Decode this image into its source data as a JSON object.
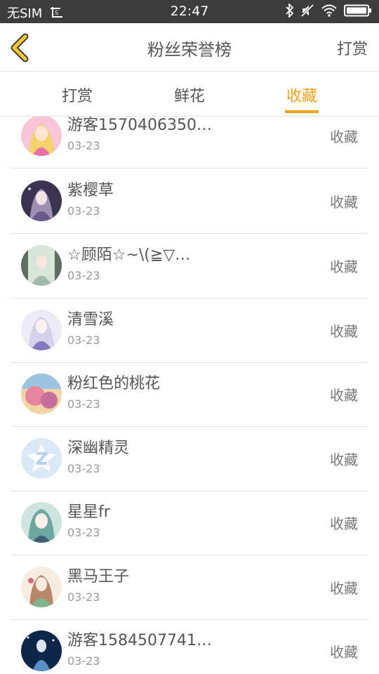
{
  "status_bar": {
    "sim": "无SIM",
    "time": "22:47"
  },
  "header": {
    "title": "粉丝荣誉榜",
    "action_label": "打赏"
  },
  "tabs": [
    {
      "label": "打赏",
      "active": false
    },
    {
      "label": "鲜花",
      "active": false
    },
    {
      "label": "收藏",
      "active": true
    }
  ],
  "colors": {
    "accent": "#f0a21b",
    "status_bar_bg": "#3c3c3c",
    "text": "#555555",
    "subtext": "#9a9a9a",
    "divider": "#e3e3e3"
  },
  "fans": [
    {
      "name": "游客1570406350…",
      "date": "03-23",
      "action": "收藏",
      "avatar": "girl-blonde-avatar"
    },
    {
      "name": "紫樱草",
      "date": "03-23",
      "action": "收藏",
      "avatar": "girl-dark-dress-avatar"
    },
    {
      "name": "☆顾陌☆~\\(≧▽…",
      "date": "03-23",
      "action": "收藏",
      "avatar": "girl-green-dress-avatar"
    },
    {
      "name": "清雪溪",
      "date": "03-23",
      "action": "收藏",
      "avatar": "girl-white-hair-avatar"
    },
    {
      "name": "粉红色的桃花",
      "date": "03-23",
      "action": "收藏",
      "avatar": "pink-flower-scene-avatar"
    },
    {
      "name": "深幽精灵",
      "date": "03-23",
      "action": "收藏",
      "avatar": "default-qq-avatar"
    },
    {
      "name": "星星fr",
      "date": "03-23",
      "action": "收藏",
      "avatar": "girl-teal-hair-avatar"
    },
    {
      "name": "黑马王子",
      "date": "03-23",
      "action": "收藏",
      "avatar": "girl-flower-dress-avatar"
    },
    {
      "name": "游客1584507741…",
      "date": "03-23",
      "action": "收藏",
      "avatar": "girl-blue-night-avatar"
    }
  ]
}
